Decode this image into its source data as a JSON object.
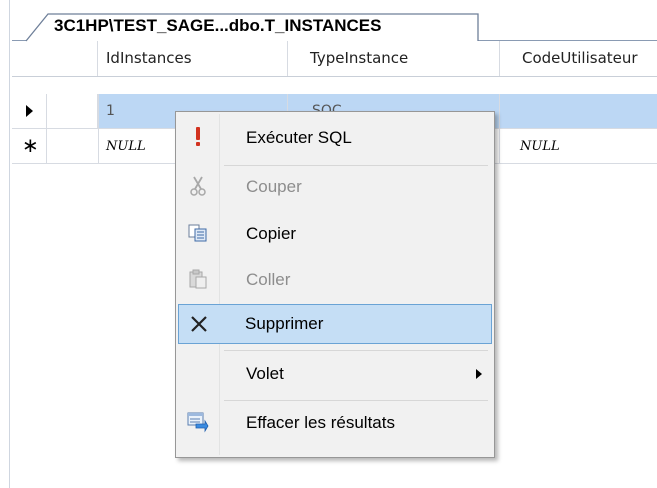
{
  "document_tab": {
    "title": "3C1HP\\TEST_SAGE...dbo.T_INSTANCES"
  },
  "grid": {
    "columns": [
      "IdInstances",
      "TypeInstance",
      "CodeUtilisateur"
    ],
    "rows": [
      {
        "indicator": "current-row-arrow",
        "cells": [
          "1",
          "SOC",
          ""
        ]
      },
      {
        "indicator": "new-row-asterisk",
        "cells": [
          "NULL",
          "",
          "NULL"
        ]
      }
    ]
  },
  "context_menu": {
    "items": [
      {
        "label": "Exécuter SQL",
        "icon": "execute-sql-icon",
        "enabled": true
      },
      {
        "label": "Couper",
        "icon": "scissors-icon",
        "enabled": false
      },
      {
        "label": "Copier",
        "icon": "copy-icon",
        "enabled": true
      },
      {
        "label": "Coller",
        "icon": "paste-icon",
        "enabled": false
      },
      {
        "label": "Supprimer",
        "icon": "delete-x-icon",
        "enabled": true,
        "highlighted": true
      },
      {
        "label": "Volet",
        "icon": "",
        "enabled": true,
        "submenu": true
      },
      {
        "label": "Effacer les résultats",
        "icon": "clear-results-icon",
        "enabled": true
      }
    ]
  },
  "colors": {
    "selection": "#bcd7f4",
    "menu_highlight": "#c5def5",
    "menu_highlight_border": "#6aa3d5",
    "disabled_text": "#8d8d8d"
  }
}
